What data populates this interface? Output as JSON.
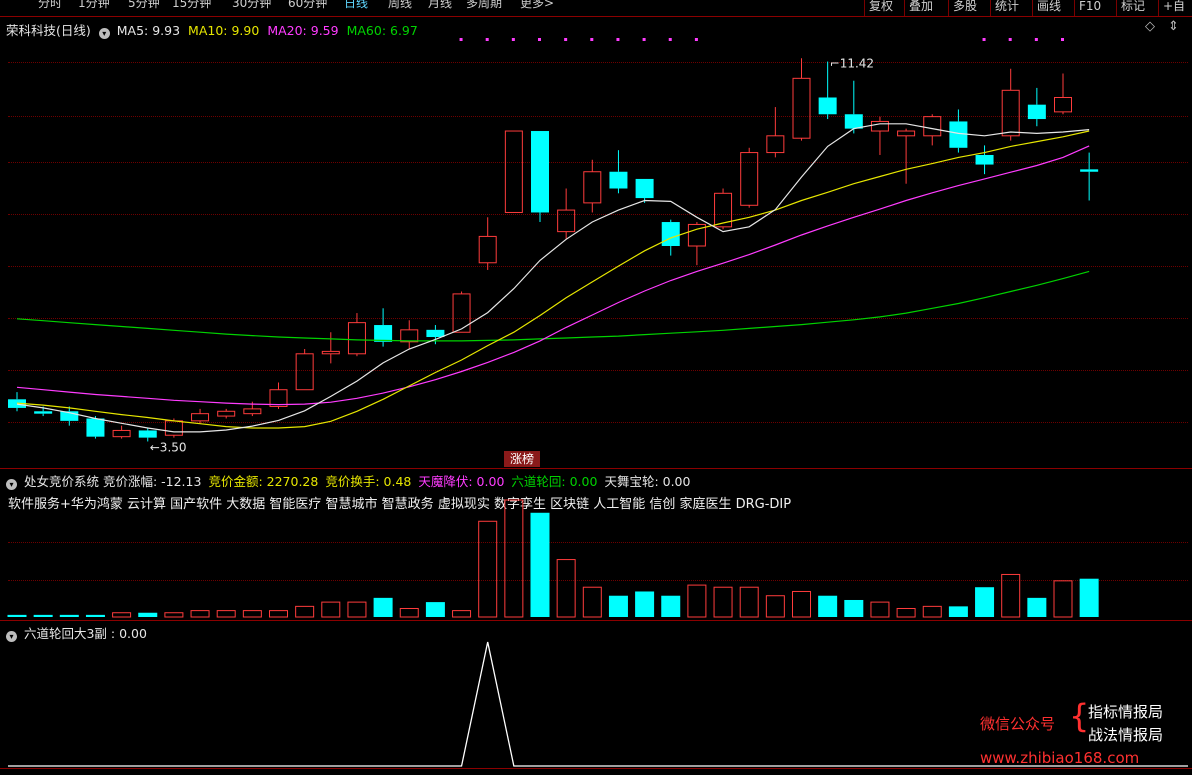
{
  "topbar": {
    "tabs": [
      "分时",
      "1分钟",
      "5分钟",
      "15分钟",
      "30分钟",
      "60分钟",
      "日线",
      "周线",
      "月线",
      "多周期",
      "更多>"
    ],
    "active": "日线",
    "right_buttons": [
      "复权",
      "叠加",
      "多股",
      "统计",
      "画线",
      "F10",
      "标记",
      "+自"
    ]
  },
  "main_header": {
    "stock": "荣科科技(日线)",
    "ma": [
      {
        "label": "MA5: 9.93",
        "color": "#e6e6e6"
      },
      {
        "label": "MA10: 9.90",
        "color": "#e6e600"
      },
      {
        "label": "MA20: 9.59",
        "color": "#ff3cff"
      },
      {
        "label": "MA60: 6.97",
        "color": "#00d200"
      }
    ]
  },
  "ind1": {
    "items": [
      {
        "label": "处女竞价系统 竞价涨幅: -12.13",
        "color": "#e6e6e6"
      },
      {
        "label": "竞价金额: 2270.28",
        "color": "#e6e600"
      },
      {
        "label": "竞价换手: 0.48",
        "color": "#e6e600"
      },
      {
        "label": "天魔降伏: 0.00",
        "color": "#ff3cff"
      },
      {
        "label": "六道轮回: 0.00",
        "color": "#00d200"
      },
      {
        "label": "天舞宝轮: 0.00",
        "color": "#e6e6e6"
      }
    ],
    "tags": "软件服务+华为鸿蒙 云计算 国产软件 大数据 智能医疗 智慧城市 智慧政务 虚拟现实 数字孪生 区块链 人工智能 信创 家庭医生 DRG-DIP"
  },
  "ind2": {
    "label": "六道轮回大3副 : 0.00"
  },
  "zhang_tag": "涨榜",
  "watermark": {
    "wx": "微信公众号",
    "brace": "{",
    "a": "指标情报局",
    "b": "战法情报局",
    "url": "www.zhibiao168.com"
  },
  "colors": {
    "up": "#ff3c3c",
    "down": "#00ffff",
    "ma5": "#e6e6e6",
    "ma10": "#e6e600",
    "ma20": "#ff3cff",
    "ma60": "#00d200"
  },
  "chart_data": {
    "type": "candlestick",
    "price_range": [
      3.2,
      11.8
    ],
    "annotations": [
      {
        "label": "11.42",
        "index": 31
      },
      {
        "label": "3.50",
        "index": 5
      }
    ],
    "candles": [
      {
        "o": 4.3,
        "c": 4.12,
        "h": 4.45,
        "l": 4.05
      },
      {
        "o": 4.05,
        "c": 4.0,
        "h": 4.15,
        "l": 3.95
      },
      {
        "o": 4.05,
        "c": 3.85,
        "h": 4.15,
        "l": 3.75
      },
      {
        "o": 3.9,
        "c": 3.52,
        "h": 3.95,
        "l": 3.48
      },
      {
        "o": 3.52,
        "c": 3.65,
        "h": 3.75,
        "l": 3.48
      },
      {
        "o": 3.65,
        "c": 3.5,
        "h": 3.7,
        "l": 3.42
      },
      {
        "o": 3.55,
        "c": 3.85,
        "h": 3.9,
        "l": 3.5
      },
      {
        "o": 3.85,
        "c": 4.0,
        "h": 4.1,
        "l": 3.8
      },
      {
        "o": 3.95,
        "c": 4.05,
        "h": 4.1,
        "l": 3.9
      },
      {
        "o": 4.0,
        "c": 4.1,
        "h": 4.25,
        "l": 3.95
      },
      {
        "o": 4.15,
        "c": 4.5,
        "h": 4.65,
        "l": 4.1
      },
      {
        "o": 4.5,
        "c": 5.25,
        "h": 5.35,
        "l": 4.5
      },
      {
        "o": 5.25,
        "c": 5.3,
        "h": 5.7,
        "l": 5.05
      },
      {
        "o": 5.25,
        "c": 5.9,
        "h": 6.1,
        "l": 5.2
      },
      {
        "o": 5.85,
        "c": 5.5,
        "h": 6.2,
        "l": 5.4
      },
      {
        "o": 5.5,
        "c": 5.75,
        "h": 5.95,
        "l": 5.35
      },
      {
        "o": 5.75,
        "c": 5.6,
        "h": 5.85,
        "l": 5.45
      },
      {
        "o": 5.7,
        "c": 6.5,
        "h": 6.55,
        "l": 5.7
      },
      {
        "o": 7.15,
        "c": 7.7,
        "h": 8.1,
        "l": 7.0
      },
      {
        "o": 8.2,
        "c": 9.9,
        "h": 9.9,
        "l": 8.2
      },
      {
        "o": 9.9,
        "c": 8.2,
        "h": 9.9,
        "l": 8.0
      },
      {
        "o": 7.8,
        "c": 8.25,
        "h": 8.7,
        "l": 7.65
      },
      {
        "o": 8.4,
        "c": 9.05,
        "h": 9.3,
        "l": 8.2
      },
      {
        "o": 9.05,
        "c": 8.7,
        "h": 9.5,
        "l": 8.6
      },
      {
        "o": 8.9,
        "c": 8.5,
        "h": 8.9,
        "l": 8.4
      },
      {
        "o": 8.0,
        "c": 7.5,
        "h": 8.05,
        "l": 7.3
      },
      {
        "o": 7.5,
        "c": 7.95,
        "h": 8.0,
        "l": 7.1
      },
      {
        "o": 7.9,
        "c": 8.6,
        "h": 8.7,
        "l": 7.85
      },
      {
        "o": 8.35,
        "c": 9.45,
        "h": 9.55,
        "l": 8.3
      },
      {
        "o": 9.45,
        "c": 9.8,
        "h": 10.4,
        "l": 9.35
      },
      {
        "o": 9.75,
        "c": 11.0,
        "h": 11.42,
        "l": 9.7
      },
      {
        "o": 10.6,
        "c": 10.25,
        "h": 11.35,
        "l": 10.15
      },
      {
        "o": 10.25,
        "c": 9.95,
        "h": 10.95,
        "l": 9.85
      },
      {
        "o": 9.9,
        "c": 10.1,
        "h": 10.2,
        "l": 9.4
      },
      {
        "o": 9.8,
        "c": 9.9,
        "h": 9.95,
        "l": 8.8
      },
      {
        "o": 9.8,
        "c": 10.2,
        "h": 10.25,
        "l": 9.6
      },
      {
        "o": 10.1,
        "c": 9.55,
        "h": 10.35,
        "l": 9.45
      },
      {
        "o": 9.4,
        "c": 9.2,
        "h": 9.6,
        "l": 9.0
      },
      {
        "o": 9.8,
        "c": 10.75,
        "h": 11.2,
        "l": 9.7
      },
      {
        "o": 10.45,
        "c": 10.15,
        "h": 10.8,
        "l": 10.0
      },
      {
        "o": 10.3,
        "c": 10.6,
        "h": 11.1,
        "l": 10.25
      },
      {
        "o": 9.1,
        "c": 9.05,
        "h": 9.45,
        "l": 8.45
      }
    ],
    "ma5": [
      4.2,
      4.12,
      4.02,
      3.9,
      3.8,
      3.7,
      3.62,
      3.62,
      3.66,
      3.74,
      3.86,
      4.06,
      4.36,
      4.68,
      5.06,
      5.35,
      5.55,
      5.77,
      6.11,
      6.61,
      7.2,
      7.64,
      8.0,
      8.25,
      8.45,
      8.43,
      8.1,
      7.8,
      7.9,
      8.26,
      8.94,
      9.58,
      9.95,
      10.05,
      10.05,
      9.95,
      9.85,
      9.8,
      9.88,
      9.85,
      9.88,
      9.93
    ],
    "ma10": [
      4.22,
      4.18,
      4.12,
      4.05,
      3.98,
      3.92,
      3.85,
      3.79,
      3.73,
      3.7,
      3.7,
      3.73,
      3.84,
      4.05,
      4.3,
      4.58,
      4.86,
      5.12,
      5.42,
      5.7,
      6.05,
      6.42,
      6.75,
      7.08,
      7.4,
      7.67,
      7.85,
      7.98,
      8.1,
      8.25,
      8.45,
      8.62,
      8.8,
      8.95,
      9.1,
      9.22,
      9.35,
      9.45,
      9.58,
      9.68,
      9.78,
      9.9
    ],
    "ma20": [
      4.55,
      4.5,
      4.45,
      4.4,
      4.36,
      4.32,
      4.28,
      4.25,
      4.22,
      4.2,
      4.19,
      4.2,
      4.24,
      4.32,
      4.43,
      4.56,
      4.71,
      4.88,
      5.07,
      5.28,
      5.52,
      5.8,
      6.06,
      6.32,
      6.56,
      6.78,
      6.97,
      7.14,
      7.32,
      7.52,
      7.73,
      7.92,
      8.1,
      8.27,
      8.45,
      8.61,
      8.76,
      8.9,
      9.04,
      9.18,
      9.35,
      9.59
    ],
    "ma60": [
      5.98,
      5.94,
      5.9,
      5.86,
      5.82,
      5.78,
      5.74,
      5.7,
      5.66,
      5.63,
      5.6,
      5.58,
      5.56,
      5.54,
      5.53,
      5.52,
      5.52,
      5.52,
      5.53,
      5.54,
      5.56,
      5.58,
      5.6,
      5.62,
      5.65,
      5.68,
      5.71,
      5.74,
      5.78,
      5.82,
      5.86,
      5.91,
      5.96,
      6.02,
      6.1,
      6.2,
      6.3,
      6.42,
      6.55,
      6.68,
      6.82,
      6.97
    ],
    "bars": [
      1,
      1,
      1,
      1,
      2,
      2,
      2,
      3,
      3,
      3,
      3,
      5,
      7,
      7,
      9,
      4,
      7,
      3,
      45,
      55,
      49,
      27,
      14,
      10,
      12,
      10,
      15,
      14,
      14,
      10,
      12,
      10,
      8,
      7,
      4,
      5,
      5,
      14,
      20,
      9,
      17,
      18
    ],
    "bar_range": [
      0,
      55
    ],
    "sub_line": [
      0,
      0,
      0,
      0,
      0,
      0,
      0,
      0,
      0,
      0,
      0,
      0,
      0,
      0,
      0,
      0,
      0,
      0,
      1,
      0,
      0,
      0,
      0,
      0,
      0,
      0,
      0,
      0,
      0,
      0,
      0,
      0,
      0,
      0,
      0,
      0,
      0,
      0,
      0,
      0,
      0,
      0
    ],
    "purple_dots": [
      17,
      18,
      19,
      20,
      21,
      22,
      23,
      24,
      25,
      26,
      37,
      38,
      39,
      40
    ]
  }
}
